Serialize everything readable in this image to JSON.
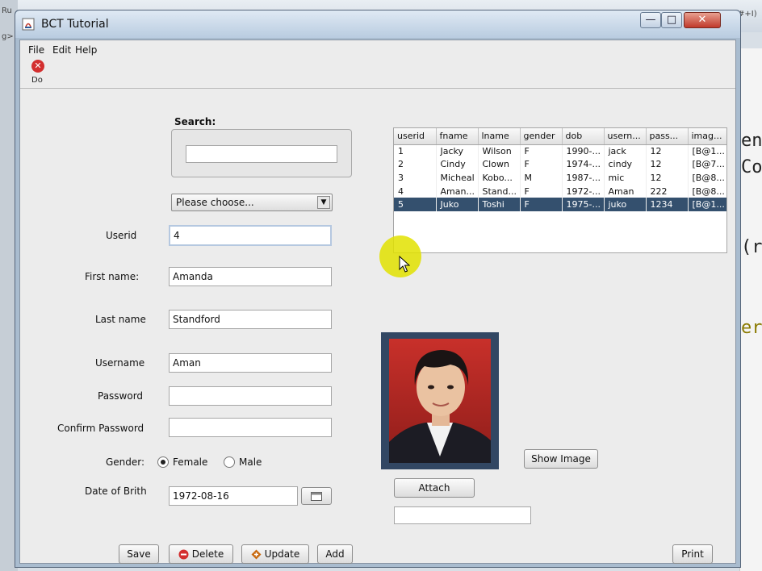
{
  "window": {
    "title": "BCT Tutorial",
    "minimize": "—",
    "maximize": "□",
    "close": "✕"
  },
  "menu": {
    "items": [
      "File",
      "Edit",
      "Help"
    ]
  },
  "toolbar": {
    "exit_label": "Do"
  },
  "search": {
    "label": "Search:",
    "value": ""
  },
  "combo": {
    "selected": "Please choose..."
  },
  "form": {
    "userid_label": "Userid",
    "userid": "4",
    "firstname_label": "First name:",
    "firstname": "Amanda",
    "lastname_label": "Last name",
    "lastname": "Standford",
    "username_label": "Username",
    "username": "Aman",
    "password_label": "Password",
    "password": "",
    "confirm_label": "Confirm Password",
    "confirm": "",
    "gender_label": "Gender:",
    "female": "Female",
    "male": "Male",
    "gender_selected": "Female",
    "dob_label": "Date of Brith",
    "dob": "1972-08-16"
  },
  "table": {
    "columns": [
      "userid",
      "fname",
      "lname",
      "gender",
      "dob",
      "usern...",
      "pass...",
      "imag..."
    ],
    "rows": [
      [
        "1",
        "Jacky",
        "Wilson",
        "F",
        "1990-...",
        "jack",
        "12",
        "[B@1..."
      ],
      [
        "2",
        "Cindy",
        "Clown",
        "F",
        "1974-...",
        "cindy",
        "12",
        "[B@7..."
      ],
      [
        "3",
        "Micheal",
        "Kobo...",
        "M",
        "1987-...",
        "mic",
        "12",
        "[B@8..."
      ],
      [
        "4",
        "Aman...",
        "Stand...",
        "F",
        "1972-...",
        "Aman",
        "222",
        "[B@8..."
      ],
      [
        "5",
        "Juko",
        "Toshi",
        "F",
        "1975-...",
        "juko",
        "1234",
        "[B@1..."
      ]
    ],
    "selected_row": 4
  },
  "buttons": {
    "show_image": "Show Image",
    "attach": "Attach",
    "save": "Save",
    "delete": "Delete",
    "update": "Update",
    "add": "Add",
    "print": "Print"
  },
  "attach_path": "",
  "background_code": [
    "ent",
    "Coo",
    "(r",
    "eri"
  ],
  "background_top": [
    "Ru",
    "g>",
    "#+I)"
  ],
  "colors": {
    "selection": "#34506e",
    "cursor_halo": "#e2e200",
    "delete": "#d32f2f",
    "update": "#c86a10"
  }
}
